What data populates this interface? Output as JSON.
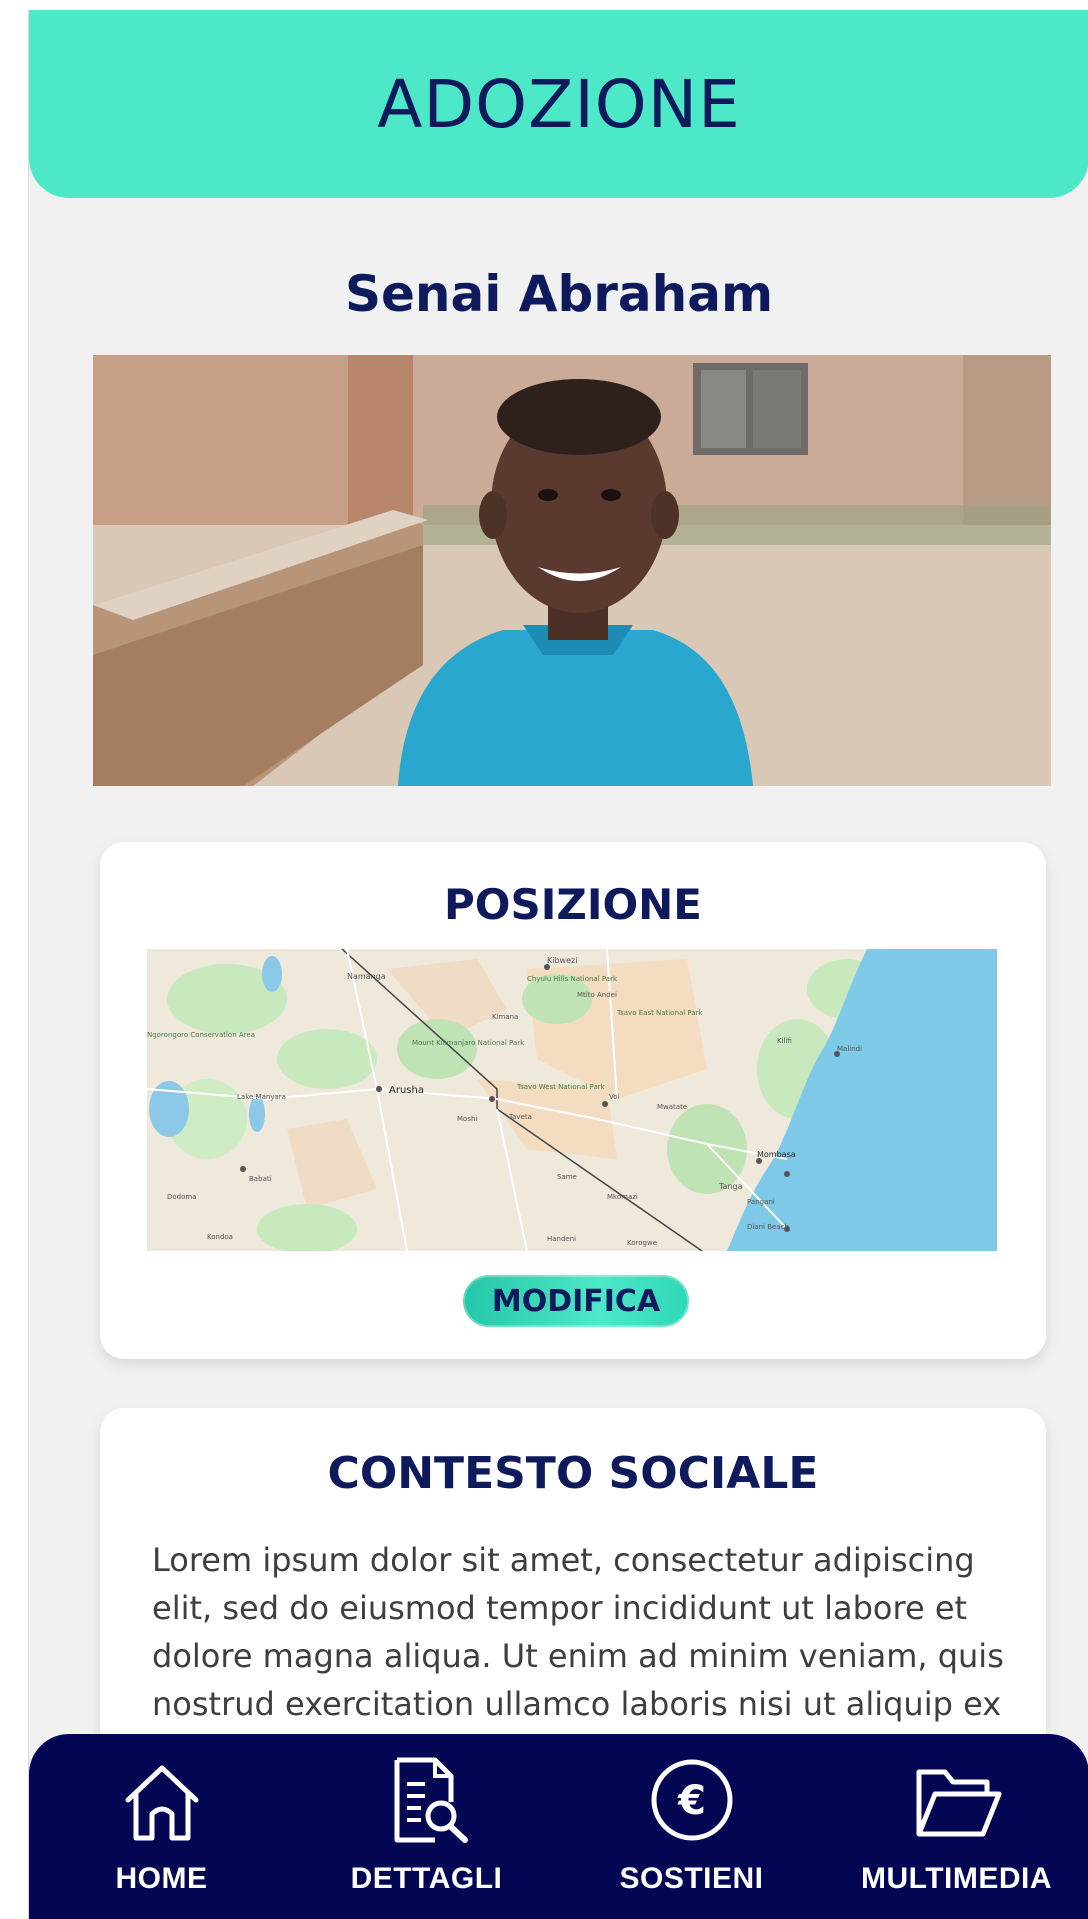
{
  "header": {
    "title": "ADOZIONE"
  },
  "child": {
    "name": "Senai Abraham"
  },
  "position_card": {
    "title": "POSIZIONE",
    "map_labels": [
      "Kibwezi",
      "Namanga",
      "Chyulu Hills National Park",
      "Mtito Andei",
      "Tsavo East National Park",
      "Kimana",
      "Mount Kilimanjaro National Park",
      "Arusha",
      "Tsavo West National Park",
      "Voi",
      "Taveta",
      "Mwatate",
      "Moshi",
      "Mombasa",
      "Ngorongoro Conservation Area",
      "Lake Manyara",
      "Babati",
      "Kilifi",
      "Malindi",
      "Dodoma",
      "Tanga",
      "Pangani",
      "Same",
      "Mkomazi",
      "Diani Beach",
      "Korogwe",
      "Handeni",
      "Kondoa"
    ],
    "button_label": "MODIFICA"
  },
  "social_card": {
    "title": "CONTESTO SOCIALE",
    "text": "Lorem ipsum dolor sit amet, consectetur adipiscing elit, sed do eiusmod tempor incididunt ut labore et dolore magna aliqua. Ut enim ad minim veniam, quis nostrud exercitation ullamco laboris nisi ut aliquip ex ea commodo consequat."
  },
  "nav": {
    "items": [
      {
        "label": "HOME",
        "icon": "home-icon"
      },
      {
        "label": "DETTAGLI",
        "icon": "document-search-icon"
      },
      {
        "label": "SOSTIENI",
        "icon": "euro-coin-icon"
      },
      {
        "label": "MULTIMEDIA",
        "icon": "folder-icon"
      }
    ]
  },
  "colors": {
    "accent": "#4de8c8",
    "navy": "#0e1a5c",
    "nav_bg": "#030653",
    "page_bg": "#f1f1f2"
  }
}
